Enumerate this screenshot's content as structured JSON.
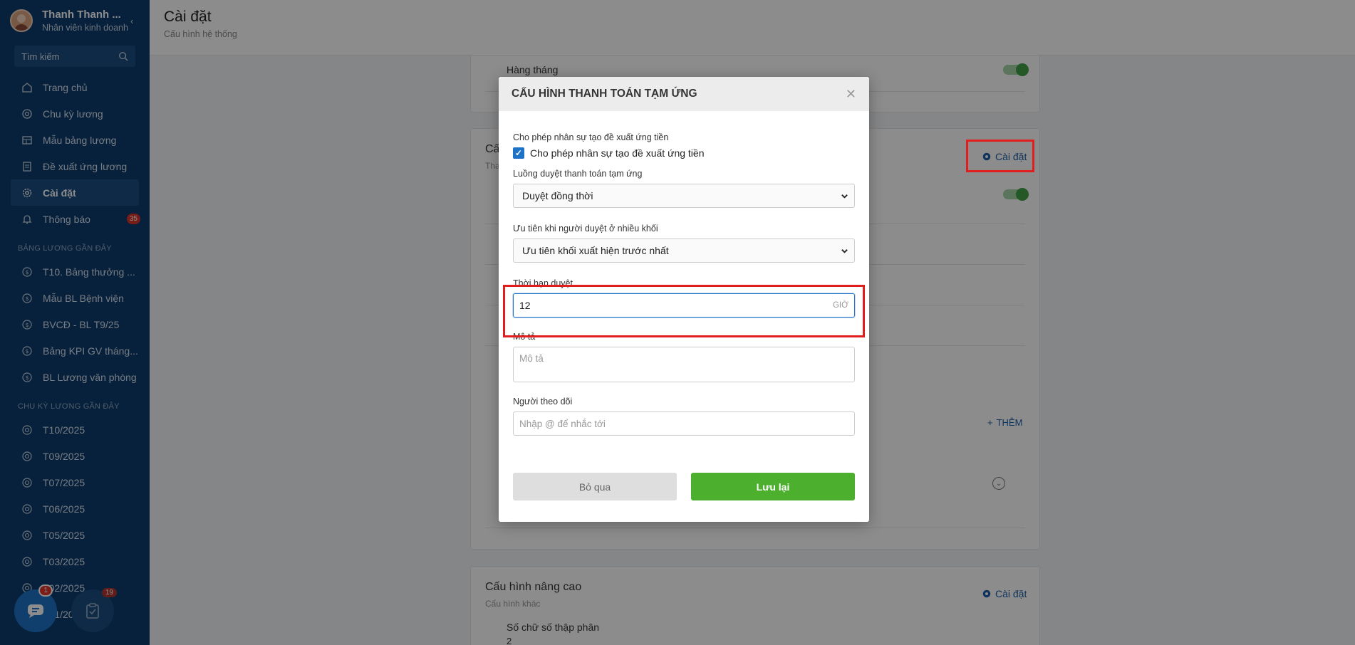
{
  "profile": {
    "name": "Thanh Thanh ...",
    "role": "Nhân viên kinh doanh"
  },
  "search": {
    "placeholder": "Tìm kiếm"
  },
  "nav": [
    {
      "label": "Trang chủ",
      "icon": "home-icon"
    },
    {
      "label": "Chu kỳ lương",
      "icon": "cycle-icon"
    },
    {
      "label": "Mẫu bảng lương",
      "icon": "table-icon"
    },
    {
      "label": "Đề xuất ứng lương",
      "icon": "document-icon"
    },
    {
      "label": "Cài đặt",
      "icon": "gear-icon",
      "active": true
    },
    {
      "label": "Thông báo",
      "icon": "bell-icon",
      "badge": "35"
    }
  ],
  "recent_payroll": {
    "title": "BẢNG LƯƠNG GẦN ĐÂY",
    "items": [
      "T10. Bảng thưởng ...",
      "Mẫu BL Bệnh viện",
      "BVCĐ - BL T9/25",
      "Bảng KPI GV tháng...",
      "BL Lương văn phòng"
    ]
  },
  "recent_cycles": {
    "title": "CHU KỲ LƯƠNG GẦN ĐÂY",
    "items": [
      "T10/2025",
      "T09/2025",
      "T07/2025",
      "T06/2025",
      "T05/2025",
      "T03/2025",
      "T02/2025",
      "T01/2025"
    ]
  },
  "fab": {
    "chat_badge": "1",
    "task_badge": "19"
  },
  "header": {
    "title": "Cài đặt",
    "subtitle": "Cấu hình hệ thống"
  },
  "bg": {
    "monthly_label": "Hàng tháng",
    "card2_title": "Cấ",
    "card2_sub": "Tha",
    "settings_label": "Cài đặt",
    "add_label": "THÊM",
    "advanced_title": "Cấu hình nâng cao",
    "advanced_sub": "Cấu hình khác",
    "advanced_settings_label": "Cài đặt",
    "decimal_label": "Số chữ số thập phân",
    "decimal_value": "2"
  },
  "modal": {
    "title": "CẤU HÌNH THANH TOÁN TẠM ỨNG",
    "allow_label": "Cho phép nhân sự tạo đề xuất ứng tiền",
    "allow_checkbox_label": "Cho phép nhân sự tạo đề xuất ứng tiền",
    "flow_label": "Luồng duyệt thanh toán tạm ứng",
    "flow_value": "Duyệt đồng thời",
    "priority_label": "Ưu tiên khi người duyệt ở nhiều khối",
    "priority_value": "Ưu tiên khối xuất hiện trước nhất",
    "deadline_label": "Thời hạn duyệt",
    "deadline_value": "12",
    "deadline_unit": "GIỜ",
    "desc_label": "Mô tả",
    "desc_placeholder": "Mô tả",
    "follower_label": "Người theo dõi",
    "follower_placeholder": "Nhập @ để nhắc tới",
    "cancel_label": "Bỏ qua",
    "save_label": "Lưu lại"
  },
  "colors": {
    "sidebar": "#0e3d6d",
    "accent": "#1e73c8",
    "save": "#4caf2e",
    "highlight": "#e01e1e"
  }
}
